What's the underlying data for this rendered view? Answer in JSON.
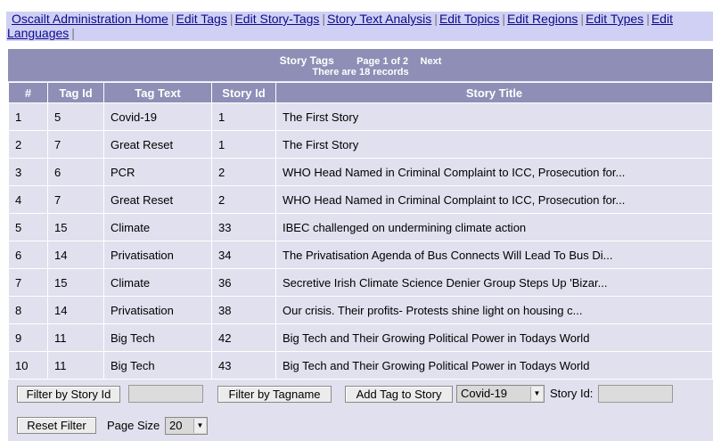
{
  "nav": {
    "links": [
      "Oscailt Administration Home",
      "Edit Tags",
      "Edit Story-Tags",
      "Story Text Analysis",
      "Edit Topics",
      "Edit Regions",
      "Edit Types",
      "Edit",
      "Languages"
    ]
  },
  "panel": {
    "title": "Story Tags",
    "page_info": "Page 1 of 2",
    "next_label": "Next",
    "record_info": "There are 18 records"
  },
  "table": {
    "headers": [
      "#",
      "Tag Id",
      "Tag Text",
      "Story Id",
      "Story Title"
    ],
    "rows": [
      [
        "1",
        "5",
        "Covid-19",
        "1",
        "The First Story"
      ],
      [
        "2",
        "7",
        "Great Reset",
        "1",
        "The First Story"
      ],
      [
        "3",
        "6",
        "PCR",
        "2",
        "WHO Head Named in Criminal Complaint to ICC, Prosecution for..."
      ],
      [
        "4",
        "7",
        "Great Reset",
        "2",
        "WHO Head Named in Criminal Complaint to ICC, Prosecution for..."
      ],
      [
        "5",
        "15",
        "Climate",
        "33",
        "IBEC challenged on undermining climate action"
      ],
      [
        "6",
        "14",
        "Privatisation",
        "34",
        "The Privatisation Agenda of Bus Connects Will Lead To Bus Di..."
      ],
      [
        "7",
        "15",
        "Climate",
        "36",
        "Secretive Irish Climate Science Denier Group Steps Up 'Bizar..."
      ],
      [
        "8",
        "14",
        "Privatisation",
        "38",
        "Our crisis. Their profits- Protests shine light on housing c..."
      ],
      [
        "9",
        "11",
        "Big Tech",
        "42",
        "Big Tech and Their Growing Political Power in Todays World"
      ],
      [
        "10",
        "11",
        "Big Tech",
        "43",
        "Big Tech and Their Growing Political Power in Todays World"
      ]
    ]
  },
  "controls": {
    "filter_story_label": "Filter by Story Id",
    "story_id_filter_value": "",
    "filter_tag_label": "Filter by Tagname",
    "add_tag_label": "Add Tag to Story",
    "tag_select_value": "Covid-19",
    "story_id_label": "Story Id:",
    "story_id_value": "",
    "reset_label": "Reset Filter",
    "page_size_label": "Page Size",
    "page_size_value": "20"
  },
  "colors": {
    "nav_bg": "#d0d0f5",
    "header_bg": "#8e8eb6",
    "row_bg": "#e0e0ee",
    "link": "#0b0b8a"
  }
}
